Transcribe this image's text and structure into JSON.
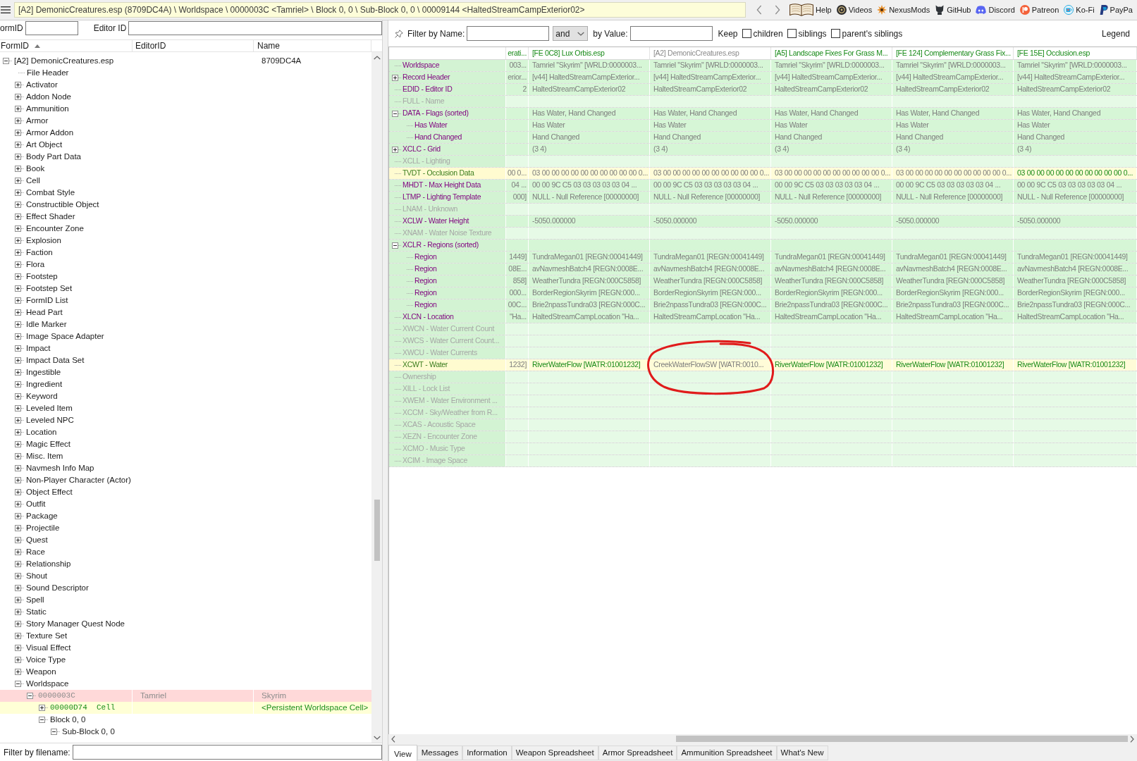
{
  "toolbar": {
    "path": "[A2] DemonicCreatures.esp (8709DC4A) \\ Worldspace \\ 0000003C <Tamriel> \\ Block 0, 0 \\ Sub-Block 0, 0 \\ 00009144 <HaltedStreamCampExterior02>",
    "links": [
      {
        "kind": "book",
        "label": "Help"
      },
      {
        "kind": "disc",
        "label": "Videos"
      },
      {
        "kind": "burst",
        "label": "NexusMods"
      },
      {
        "kind": "cat",
        "label": "GitHub"
      },
      {
        "kind": "controller",
        "label": "Discord"
      },
      {
        "kind": "dot",
        "label": "Patreon"
      },
      {
        "kind": "cup",
        "label": "Ko-Fi"
      },
      {
        "kind": "logo",
        "label": "PayPa"
      }
    ]
  },
  "search": {
    "form_id_label": "ormID",
    "editor_id_label": "Editor ID"
  },
  "tree": {
    "columns": [
      {
        "label": "FormID",
        "sorted": true
      },
      {
        "label": "EditorID",
        "sorted": false
      },
      {
        "label": "Name",
        "sorted": false
      }
    ],
    "root": {
      "label": "[A2] DemonicCreatures.esp",
      "name": "8709DC4A",
      "expanded": true,
      "children": [
        {
          "kind": "group",
          "label": "File Header"
        },
        {
          "kind": "group",
          "label": "Activator",
          "expanded": false
        },
        {
          "kind": "group",
          "label": "Addon Node",
          "expanded": false
        },
        {
          "kind": "group",
          "label": "Ammunition",
          "expanded": false
        },
        {
          "kind": "group",
          "label": "Armor",
          "expanded": false
        },
        {
          "kind": "group",
          "label": "Armor Addon",
          "expanded": false
        },
        {
          "kind": "group",
          "label": "Art Object",
          "expanded": false
        },
        {
          "kind": "group",
          "label": "Body Part Data",
          "expanded": false
        },
        {
          "kind": "group",
          "label": "Book",
          "expanded": false
        },
        {
          "kind": "group",
          "label": "Cell",
          "expanded": false
        },
        {
          "kind": "group",
          "label": "Combat Style",
          "expanded": false
        },
        {
          "kind": "group",
          "label": "Constructible Object",
          "expanded": false
        },
        {
          "kind": "group",
          "label": "Effect Shader",
          "expanded": false
        },
        {
          "kind": "group",
          "label": "Encounter Zone",
          "expanded": false
        },
        {
          "kind": "group",
          "label": "Explosion",
          "expanded": false
        },
        {
          "kind": "group",
          "label": "Faction",
          "expanded": false
        },
        {
          "kind": "group",
          "label": "Flora",
          "expanded": false
        },
        {
          "kind": "group",
          "label": "Footstep",
          "expanded": false
        },
        {
          "kind": "group",
          "label": "Footstep Set",
          "expanded": false
        },
        {
          "kind": "group",
          "label": "FormID List",
          "expanded": false
        },
        {
          "kind": "group",
          "label": "Head Part",
          "expanded": false
        },
        {
          "kind": "group",
          "label": "Idle Marker",
          "expanded": false
        },
        {
          "kind": "group",
          "label": "Image Space Adapter",
          "expanded": false
        },
        {
          "kind": "group",
          "label": "Impact",
          "expanded": false
        },
        {
          "kind": "group",
          "label": "Impact Data Set",
          "expanded": false
        },
        {
          "kind": "group",
          "label": "Ingestible",
          "expanded": false
        },
        {
          "kind": "group",
          "label": "Ingredient",
          "expanded": false
        },
        {
          "kind": "group",
          "label": "Keyword",
          "expanded": false
        },
        {
          "kind": "group",
          "label": "Leveled Item",
          "expanded": false
        },
        {
          "kind": "group",
          "label": "Leveled NPC",
          "expanded": false
        },
        {
          "kind": "group",
          "label": "Location",
          "expanded": false
        },
        {
          "kind": "group",
          "label": "Magic Effect",
          "expanded": false
        },
        {
          "kind": "group",
          "label": "Misc. Item",
          "expanded": false
        },
        {
          "kind": "group",
          "label": "Navmesh Info Map",
          "expanded": false
        },
        {
          "kind": "group",
          "label": "Non-Player Character (Actor)",
          "expanded": false
        },
        {
          "kind": "group",
          "label": "Object Effect",
          "expanded": false
        },
        {
          "kind": "group",
          "label": "Outfit",
          "expanded": false
        },
        {
          "kind": "group",
          "label": "Package",
          "expanded": false
        },
        {
          "kind": "group",
          "label": "Projectile",
          "expanded": false
        },
        {
          "kind": "group",
          "label": "Quest",
          "expanded": false
        },
        {
          "kind": "group",
          "label": "Race",
          "expanded": false
        },
        {
          "kind": "group",
          "label": "Relationship",
          "expanded": false
        },
        {
          "kind": "group",
          "label": "Shout",
          "expanded": false
        },
        {
          "kind": "group",
          "label": "Sound Descriptor",
          "expanded": false
        },
        {
          "kind": "group",
          "label": "Spell",
          "expanded": false
        },
        {
          "kind": "group",
          "label": "Static",
          "expanded": false
        },
        {
          "kind": "group",
          "label": "Story Manager Quest Node",
          "expanded": false
        },
        {
          "kind": "group",
          "label": "Texture Set",
          "expanded": false
        },
        {
          "kind": "group",
          "label": "Visual Effect",
          "expanded": false
        },
        {
          "kind": "group",
          "label": "Voice Type",
          "expanded": false
        },
        {
          "kind": "group",
          "label": "Weapon",
          "expanded": false
        },
        {
          "kind": "group",
          "label": "Worldspace",
          "expanded": true,
          "children": [
            {
              "kind": "record",
              "label": "0000003C",
              "editor_id": "Tamriel",
              "name": "Skyrim",
              "conflict": true,
              "override": false,
              "expanded": true,
              "children": [
                {
                  "kind": "record",
                  "label": "00000D74  Cell",
                  "name": "<Persistent Worldspace Cell>",
                  "conflict": false,
                  "override": true,
                  "expanded": false
                },
                {
                  "kind": "group",
                  "label": "Block 0, 0",
                  "conflict": false,
                  "override": false,
                  "expanded": true,
                  "children": [
                    {
                      "kind": "group",
                      "label": "Sub-Block 0, 0",
                      "expanded": true
                    }
                  ]
                }
              ]
            }
          ]
        }
      ]
    }
  },
  "filename_filter": {
    "label": "Filter by filename:"
  },
  "filter": {
    "name_label": "Filter by Name:",
    "operator": "and",
    "value_label": "by Value:",
    "keep_label": "Keep",
    "options": [
      {
        "label": "children",
        "checked": false
      },
      {
        "label": "siblings",
        "checked": false
      },
      {
        "label": "parent's siblings",
        "checked": false
      }
    ],
    "legend": "Legend"
  },
  "record": {
    "columns": [
      {
        "label": "erati...",
        "highlighted": true
      },
      {
        "label": "[FE 0C8] Lux Orbis.esp",
        "highlighted": true
      },
      {
        "label": "[A2] DemonicCreatures.esp",
        "highlighted": false
      },
      {
        "label": "[A5] Landscape Fixes For Grass M...",
        "highlighted": true
      },
      {
        "label": "[FE 124] Complementary Grass Fix...",
        "highlighted": true
      },
      {
        "label": "[FE 15E] Occlusion.esp",
        "highlighted": true
      }
    ],
    "rows": [
      {
        "label": "Worldspace",
        "present": true,
        "conflict": false,
        "cells": [
          {
            "text": "003...",
            "highlighted": false
          },
          {
            "text": "Tamriel \"Skyrim\" [WRLD:0000003...",
            "highlighted": false
          },
          {
            "text": "Tamriel \"Skyrim\" [WRLD:0000003...",
            "highlighted": false
          },
          {
            "text": "Tamriel \"Skyrim\" [WRLD:0000003...",
            "highlighted": false
          },
          {
            "text": "Tamriel \"Skyrim\" [WRLD:0000003...",
            "highlighted": false
          },
          {
            "text": "Tamriel \"Skyrim\" [WRLD:0000003...",
            "highlighted": false
          }
        ]
      },
      {
        "label": "Record Header",
        "present": true,
        "conflict": false,
        "expanded": false,
        "cells": [
          {
            "text": "erior...",
            "highlighted": false
          },
          {
            "text": "[v44] HaltedStreamCampExterior...",
            "highlighted": false
          },
          {
            "text": "[v44] HaltedStreamCampExterior...",
            "highlighted": false
          },
          {
            "text": "[v44] HaltedStreamCampExterior...",
            "highlighted": false
          },
          {
            "text": "[v44] HaltedStreamCampExterior...",
            "highlighted": false
          },
          {
            "text": "[v44] HaltedStreamCampExterior...",
            "highlighted": false
          }
        ]
      },
      {
        "label": "EDID - Editor ID",
        "present": true,
        "conflict": false,
        "cells": [
          {
            "text": "2",
            "highlighted": false
          },
          {
            "text": "HaltedStreamCampExterior02",
            "highlighted": false
          },
          {
            "text": "HaltedStreamCampExterior02",
            "highlighted": false
          },
          {
            "text": "HaltedStreamCampExterior02",
            "highlighted": false
          },
          {
            "text": "HaltedStreamCampExterior02",
            "highlighted": false
          },
          {
            "text": "HaltedStreamCampExterior02",
            "highlighted": false
          }
        ]
      },
      {
        "label": "FULL - Name",
        "present": false,
        "conflict": false
      },
      {
        "label": "DATA - Flags (sorted)",
        "present": true,
        "conflict": false,
        "expanded": true,
        "cells": [
          null,
          {
            "text": "Has Water, Hand Changed",
            "highlighted": false
          },
          {
            "text": "Has Water, Hand Changed",
            "highlighted": false
          },
          {
            "text": "Has Water, Hand Changed",
            "highlighted": false
          },
          {
            "text": "Has Water, Hand Changed",
            "highlighted": false
          },
          {
            "text": "Has Water, Hand Changed",
            "highlighted": false
          }
        ],
        "children": [
          {
            "label": "Has Water",
            "present": true,
            "conflict": false,
            "cells": [
              null,
              {
                "text": "Has Water",
                "highlighted": false
              },
              {
                "text": "Has Water",
                "highlighted": false
              },
              {
                "text": "Has Water",
                "highlighted": false
              },
              {
                "text": "Has Water",
                "highlighted": false
              },
              {
                "text": "Has Water",
                "highlighted": false
              }
            ]
          },
          {
            "label": "Hand Changed",
            "present": true,
            "conflict": false,
            "cells": [
              null,
              {
                "text": "Hand Changed",
                "highlighted": false
              },
              {
                "text": "Hand Changed",
                "highlighted": false
              },
              {
                "text": "Hand Changed",
                "highlighted": false
              },
              {
                "text": "Hand Changed",
                "highlighted": false
              },
              {
                "text": "Hand Changed",
                "highlighted": false
              }
            ]
          }
        ]
      },
      {
        "label": "XCLC - Grid",
        "present": true,
        "conflict": false,
        "expanded": false,
        "cells": [
          null,
          {
            "text": "(3 4)",
            "highlighted": false
          },
          {
            "text": "(3 4)",
            "highlighted": false
          },
          {
            "text": "(3 4)",
            "highlighted": false
          },
          {
            "text": "(3 4)",
            "highlighted": false
          },
          {
            "text": "(3 4)",
            "highlighted": false
          }
        ]
      },
      {
        "label": "XCLL - Lighting",
        "present": false,
        "conflict": false
      },
      {
        "label": "TVDT - Occlusion Data",
        "present": true,
        "conflict": true,
        "cells": [
          {
            "text": "00 0...",
            "highlighted": false
          },
          {
            "text": "03 00 00 00 00 00 00 00 00 00 00 0...",
            "highlighted": false
          },
          {
            "text": "03 00 00 00 00 00 00 00 00 00 00 0...",
            "highlighted": false
          },
          {
            "text": "03 00 00 00 00 00 00 00 00 00 00 0...",
            "highlighted": false
          },
          {
            "text": "03 00 00 00 00 00 00 00 00 00 00 0...",
            "highlighted": false
          },
          {
            "text": "03 00 00 00 00 00 00 00 00 00 00 0...",
            "highlighted": true
          }
        ]
      },
      {
        "label": "MHDT - Max Height Data",
        "present": true,
        "conflict": false,
        "cells": [
          {
            "text": "04 ...",
            "highlighted": false
          },
          {
            "text": "00 00 9C C5 03 03 03 03 03 04 ...",
            "highlighted": false
          },
          {
            "text": "00 00 9C C5 03 03 03 03 03 04 ...",
            "highlighted": false
          },
          {
            "text": "00 00 9C C5 03 03 03 03 03 04 ...",
            "highlighted": false
          },
          {
            "text": "00 00 9C C5 03 03 03 03 03 04 ...",
            "highlighted": false
          },
          {
            "text": "00 00 9C C5 03 03 03 03 03 04 ...",
            "highlighted": false
          }
        ]
      },
      {
        "label": "LTMP - Lighting Template",
        "present": true,
        "conflict": false,
        "cells": [
          {
            "text": "000]",
            "highlighted": false
          },
          {
            "text": "NULL - Null Reference [00000000]",
            "highlighted": false
          },
          {
            "text": "NULL - Null Reference [00000000]",
            "highlighted": false
          },
          {
            "text": "NULL - Null Reference [00000000]",
            "highlighted": false
          },
          {
            "text": "NULL - Null Reference [00000000]",
            "highlighted": false
          },
          {
            "text": "NULL - Null Reference [00000000]",
            "highlighted": false
          }
        ]
      },
      {
        "label": "LNAM - Unknown",
        "present": false,
        "conflict": false
      },
      {
        "label": "XCLW - Water Height",
        "present": true,
        "conflict": false,
        "cells": [
          null,
          {
            "text": "-5050.000000",
            "highlighted": false
          },
          {
            "text": "-5050.000000",
            "highlighted": false
          },
          {
            "text": "-5050.000000",
            "highlighted": false
          },
          {
            "text": "-5050.000000",
            "highlighted": false
          },
          {
            "text": "-5050.000000",
            "highlighted": false
          }
        ]
      },
      {
        "label": "XNAM - Water Noise Texture",
        "present": false,
        "conflict": false
      },
      {
        "label": "XCLR - Regions (sorted)",
        "present": true,
        "conflict": false,
        "expanded": true,
        "children": [
          {
            "label": "Region",
            "present": true,
            "conflict": false,
            "cells": [
              {
                "text": "1449]",
                "highlighted": false
              },
              {
                "text": "TundraMegan01 [REGN:00041449]",
                "highlighted": false
              },
              {
                "text": "TundraMegan01 [REGN:00041449]",
                "highlighted": false
              },
              {
                "text": "TundraMegan01 [REGN:00041449]",
                "highlighted": false
              },
              {
                "text": "TundraMegan01 [REGN:00041449]",
                "highlighted": false
              },
              {
                "text": "TundraMegan01 [REGN:00041449]",
                "highlighted": false
              }
            ]
          },
          {
            "label": "Region",
            "present": true,
            "conflict": false,
            "cells": [
              {
                "text": "08E...",
                "highlighted": false
              },
              {
                "text": "avNavmeshBatch4 [REGN:0008E...",
                "highlighted": false
              },
              {
                "text": "avNavmeshBatch4 [REGN:0008E...",
                "highlighted": false
              },
              {
                "text": "avNavmeshBatch4 [REGN:0008E...",
                "highlighted": false
              },
              {
                "text": "avNavmeshBatch4 [REGN:0008E...",
                "highlighted": false
              },
              {
                "text": "avNavmeshBatch4 [REGN:0008E...",
                "highlighted": false
              }
            ]
          },
          {
            "label": "Region",
            "present": true,
            "conflict": false,
            "cells": [
              {
                "text": "858]",
                "highlighted": false
              },
              {
                "text": "WeatherTundra [REGN:000C5858]",
                "highlighted": false
              },
              {
                "text": "WeatherTundra [REGN:000C5858]",
                "highlighted": false
              },
              {
                "text": "WeatherTundra [REGN:000C5858]",
                "highlighted": false
              },
              {
                "text": "WeatherTundra [REGN:000C5858]",
                "highlighted": false
              },
              {
                "text": "WeatherTundra [REGN:000C5858]",
                "highlighted": false
              }
            ]
          },
          {
            "label": "Region",
            "present": true,
            "conflict": false,
            "cells": [
              {
                "text": "000...",
                "highlighted": false
              },
              {
                "text": "BorderRegionSkyrim [REGN:000...",
                "highlighted": false
              },
              {
                "text": "BorderRegionSkyrim [REGN:000...",
                "highlighted": false
              },
              {
                "text": "BorderRegionSkyrim [REGN:000...",
                "highlighted": false
              },
              {
                "text": "BorderRegionSkyrim [REGN:000...",
                "highlighted": false
              },
              {
                "text": "BorderRegionSkyrim [REGN:000...",
                "highlighted": false
              }
            ]
          },
          {
            "label": "Region",
            "present": true,
            "conflict": false,
            "cells": [
              {
                "text": "00C...",
                "highlighted": false
              },
              {
                "text": "Brie2npassTundra03 [REGN:000C...",
                "highlighted": false
              },
              {
                "text": "Brie2npassTundra03 [REGN:000C...",
                "highlighted": false
              },
              {
                "text": "Brie2npassTundra03 [REGN:000C...",
                "highlighted": false
              },
              {
                "text": "Brie2npassTundra03 [REGN:000C...",
                "highlighted": false
              },
              {
                "text": "Brie2npassTundra03 [REGN:000C...",
                "highlighted": false
              }
            ]
          }
        ]
      },
      {
        "label": "XLCN - Location",
        "present": true,
        "conflict": false,
        "cells": [
          {
            "text": "\"Ha...",
            "highlighted": false
          },
          {
            "text": "HaltedStreamCampLocation \"Ha...",
            "highlighted": false
          },
          {
            "text": "HaltedStreamCampLocation \"Ha...",
            "highlighted": false
          },
          {
            "text": "HaltedStreamCampLocation \"Ha...",
            "highlighted": false
          },
          {
            "text": "HaltedStreamCampLocation \"Ha...",
            "highlighted": false
          },
          {
            "text": "HaltedStreamCampLocation \"Ha...",
            "highlighted": false
          }
        ]
      },
      {
        "label": "XWCN - Water Current Count",
        "present": false,
        "conflict": false
      },
      {
        "label": "XWCS - Water Current Count...",
        "present": false,
        "conflict": false
      },
      {
        "label": "XWCU - Water Currents",
        "present": false,
        "conflict": false
      },
      {
        "label": "XCWT - Water",
        "present": true,
        "conflict": true,
        "cells": [
          {
            "text": "1232]",
            "highlighted": false
          },
          {
            "text": "RiverWaterFlow [WATR:01001232]",
            "highlighted": true
          },
          {
            "text": "CreekWaterFlowSW [WATR:0010...",
            "highlighted": false,
            "circled": true
          },
          {
            "text": "RiverWaterFlow [WATR:01001232]",
            "highlighted": true
          },
          {
            "text": "RiverWaterFlow [WATR:01001232]",
            "highlighted": true
          },
          {
            "text": "RiverWaterFlow [WATR:01001232]",
            "highlighted": true
          }
        ]
      },
      {
        "label": "Ownership",
        "present": false,
        "conflict": false
      },
      {
        "label": "XILL - Lock List",
        "present": false,
        "conflict": false
      },
      {
        "label": "XWEM - Water Environment ...",
        "present": false,
        "conflict": false
      },
      {
        "label": "XCCM - Sky/Weather from R...",
        "present": false,
        "conflict": false
      },
      {
        "label": "XCAS - Acoustic Space",
        "present": false,
        "conflict": false
      },
      {
        "label": "XEZN - Encounter Zone",
        "present": false,
        "conflict": false
      },
      {
        "label": "XCMO - Music Type",
        "present": false,
        "conflict": false
      },
      {
        "label": "XCIM - Image Space",
        "present": false,
        "conflict": false
      }
    ]
  },
  "tabs": [
    {
      "label": "View",
      "selected": true
    },
    {
      "label": "Messages",
      "selected": false
    },
    {
      "label": "Information",
      "selected": false
    },
    {
      "label": "Weapon Spreadsheet",
      "selected": false
    },
    {
      "label": "Armor Spreadsheet",
      "selected": false
    },
    {
      "label": "Ammunition Spreadsheet",
      "selected": false
    },
    {
      "label": "What's New",
      "selected": false
    }
  ]
}
